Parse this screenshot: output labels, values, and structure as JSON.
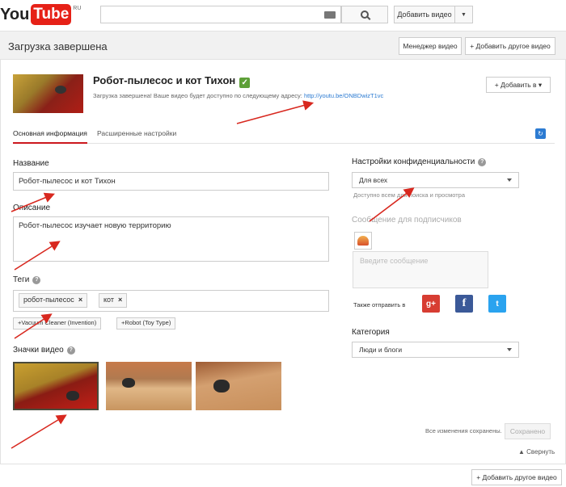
{
  "topbar": {
    "logo_you": "You",
    "logo_tube": "Tube",
    "logo_region": "RU",
    "search_placeholder": "",
    "upload_label": "Добавить видео"
  },
  "header": {
    "title": "Загрузка завершена",
    "manager_label": "Менеджер видео",
    "add_another_label": "+ Добавить другое видео"
  },
  "video": {
    "title": "Робот-пылесос и кот Тихон",
    "status_text": "Загрузка завершена! Ваше видео будет доступно по следующему адресу:",
    "link": "http://youtu.be/ONBDwizT1vc",
    "add_to_label": "+ Добавить в ▾"
  },
  "tabs": [
    {
      "label": "Основная информация"
    },
    {
      "label": "Расширенные настройки"
    }
  ],
  "form": {
    "title_label": "Название",
    "title_value": "Робот-пылесос и кот Тихон",
    "description_label": "Описание",
    "description_value": "Робот-пылесос изучает новую территорию",
    "tags_label": "Теги",
    "tags": [
      "робот-пылесос",
      "кот"
    ],
    "suggestions": [
      "+Vacuum Cleaner (Invention)",
      "+Robot (Toy Type)"
    ],
    "thumbnails_label": "Значки видео"
  },
  "privacy": {
    "label": "Настройки конфиденциальности",
    "value": "Для всех",
    "note": "Доступно всем для поиска и просмотра"
  },
  "subscribers": {
    "label": "Сообщение для подписчиков",
    "placeholder": "Введите сообщение",
    "share_label": "Также отправить в"
  },
  "category": {
    "label": "Категория",
    "value": "Люди и блоги"
  },
  "footer": {
    "saved_note": "Все изменения сохранены.",
    "saved_button": "Сохранено",
    "collapse_label": "▲ Свернуть",
    "add_another_bottom": "+ Добавить другое видео"
  },
  "colors": {
    "accent_red": "#cc181e",
    "youtube_red": "#e62117",
    "annotation_red": "#d8281f",
    "link_blue": "#2c7bd2"
  }
}
